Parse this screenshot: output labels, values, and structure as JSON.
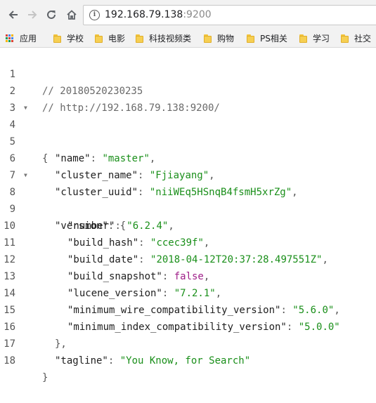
{
  "browser": {
    "url_host": "192.168.79.138",
    "url_port": ":9200"
  },
  "bookmarks": [
    {
      "label": "应用",
      "icon": "apps-grid-icon"
    },
    {
      "label": "学校",
      "icon": "folder-icon"
    },
    {
      "label": "电影",
      "icon": "folder-icon"
    },
    {
      "label": "科技视频类",
      "icon": "folder-icon"
    },
    {
      "label": "购物",
      "icon": "folder-icon"
    },
    {
      "label": "PS相关",
      "icon": "folder-icon"
    },
    {
      "label": "学习",
      "icon": "folder-icon"
    },
    {
      "label": "社交",
      "icon": "folder-icon"
    }
  ],
  "colors": {
    "string": "#1a8f1a",
    "boolean": "#a0208a",
    "comment": "#6a6a6a",
    "folder": "#f6cf52"
  },
  "json_view": {
    "line_numbers": [
      "1",
      "2",
      "3",
      "4",
      "5",
      "6",
      "7",
      "8",
      "9",
      "10",
      "11",
      "12",
      "13",
      "14",
      "15",
      "16",
      "17",
      "18"
    ],
    "comment_date": "// 20180520230235",
    "comment_url": "// http://192.168.79.138:9200/",
    "brace_open": "{",
    "brace_close": "}",
    "name_key": "\"name\"",
    "name_value": "\"master\"",
    "cluster_name_key": "\"cluster_name\"",
    "cluster_name_value": "\"Fjiayang\"",
    "cluster_uuid_key": "\"cluster_uuid\"",
    "cluster_uuid_value": "\"niiWEq5HSnqB4fsmH5xrZg\"",
    "version_key": "\"version\"",
    "number_key": "\"number\"",
    "number_value": "\"6.2.4\"",
    "build_hash_key": "\"build_hash\"",
    "build_hash_value": "\"ccec39f\"",
    "build_date_key": "\"build_date\"",
    "build_date_value": "\"2018-04-12T20:37:28.497551Z\"",
    "build_snapshot_key": "\"build_snapshot\"",
    "build_snapshot_value": "false",
    "lucene_version_key": "\"lucene_version\"",
    "lucene_version_value": "\"7.2.1\"",
    "min_wire_key": "\"minimum_wire_compatibility_version\"",
    "min_wire_value": "\"5.6.0\"",
    "min_index_key": "\"minimum_index_compatibility_version\"",
    "min_index_value": "\"5.0.0\"",
    "version_close": "},",
    "tagline_key": "\"tagline\"",
    "tagline_value": "\"You Know, for Search\""
  }
}
